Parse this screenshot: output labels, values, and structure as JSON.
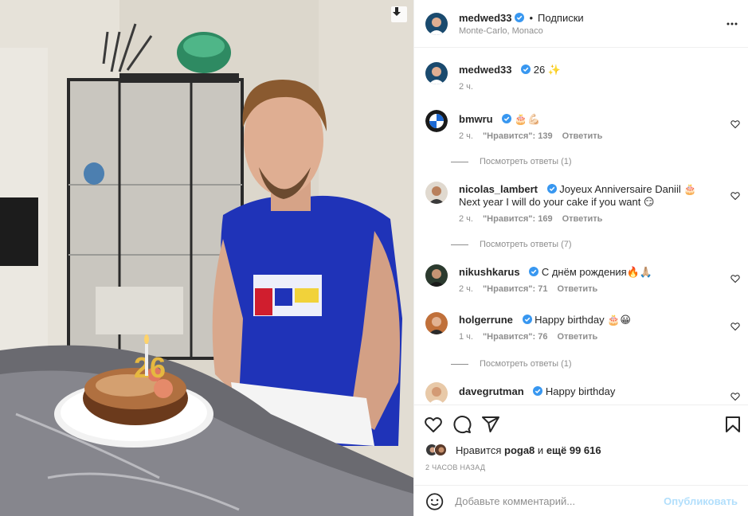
{
  "post": {
    "author": "medwed33",
    "follow_label": "Подписки",
    "location": "Monte-Carlo, Monaco",
    "caption_text": "26 ✨",
    "caption_time": "2 ч."
  },
  "comments": [
    {
      "user": "bmwru",
      "verified": true,
      "text": "🎂💪🏻",
      "time": "2 ч.",
      "likes": "\"Нравится\": 139",
      "reply": "Ответить",
      "replies": "Посмотреть ответы (1)"
    },
    {
      "user": "nicolas_lambert",
      "verified": true,
      "text": "Joyeux Anniversaire Daniil 🎂",
      "text2": "Next year I will do your cake if you want 😏",
      "time": "2 ч.",
      "likes": "\"Нравится\": 169",
      "reply": "Ответить",
      "replies": "Посмотреть ответы (7)"
    },
    {
      "user": "nikushkarus",
      "verified": true,
      "text": "С днём рождения🔥🙏🏼",
      "time": "2 ч.",
      "likes": "\"Нравится\": 71",
      "reply": "Ответить"
    },
    {
      "user": "holgerrune",
      "verified": true,
      "text": "Happy birthday 🎂😀",
      "time": "1 ч.",
      "likes": "\"Нравится\": 76",
      "reply": "Ответить",
      "replies": "Посмотреть ответы (1)"
    },
    {
      "user": "davegrutman",
      "verified": true,
      "text": "Happy birthday"
    }
  ],
  "likes": {
    "prefix": "Нравится",
    "user": "poga8",
    "middle": "и",
    "count": "ещё 99 616"
  },
  "timestamp": "2 часов назад",
  "composer": {
    "placeholder": "Добавьте комментарий...",
    "publish_label": "Опубликовать"
  },
  "photo": {
    "candle_number": "26"
  },
  "colors": {
    "verified": "#3897f0",
    "shirt": "#1f33b8",
    "publish_disabled": "#b2dffc"
  },
  "icons": [
    "download-icon",
    "more-icon",
    "heart-icon",
    "comment-icon",
    "share-icon",
    "bookmark-icon",
    "emoji-icon",
    "verified-icon"
  ]
}
